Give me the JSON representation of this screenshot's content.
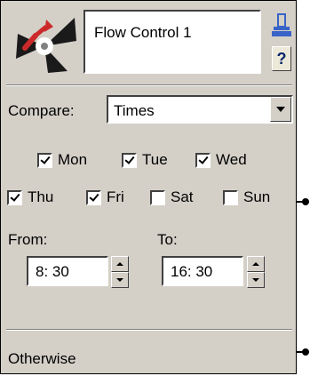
{
  "header": {
    "title": "Flow Control 1",
    "help_label": "?"
  },
  "compare": {
    "label": "Compare:",
    "value": "Times"
  },
  "days": [
    {
      "label": "Mon",
      "checked": true
    },
    {
      "label": "Tue",
      "checked": true
    },
    {
      "label": "Wed",
      "checked": true
    },
    {
      "label": "Thu",
      "checked": true
    },
    {
      "label": "Fri",
      "checked": true
    },
    {
      "label": "Sat",
      "checked": false
    },
    {
      "label": "Sun",
      "checked": false
    }
  ],
  "time": {
    "from_label": "From:",
    "from_value": "8: 30",
    "to_label": "To:",
    "to_value": "16: 30"
  },
  "otherwise_label": "Otherwise",
  "colors": {
    "panel": "#d4d0c8",
    "icon_red": "#cc2a2a",
    "icon_dark": "#1a1a1a",
    "pin_blue": "#3a63c8"
  }
}
